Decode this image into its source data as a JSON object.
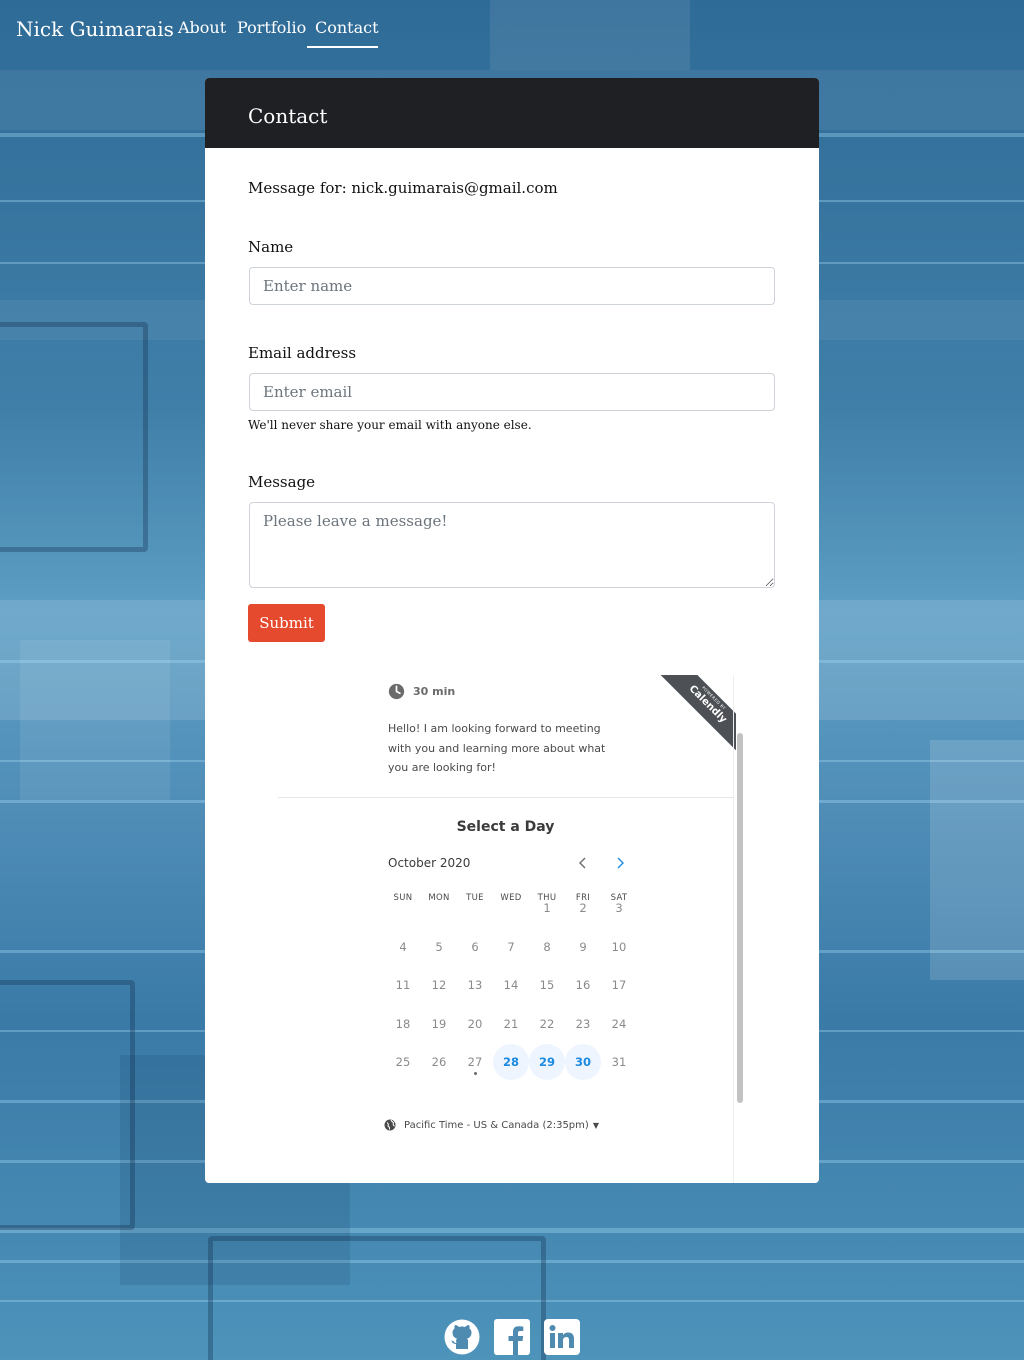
{
  "nav": {
    "brand": "Nick Guimarais",
    "links": [
      "About",
      "Portfolio",
      "Contact"
    ],
    "active": "Contact"
  },
  "card": {
    "title": "Contact",
    "message_for": "Message for: nick.guimarais@gmail.com"
  },
  "form": {
    "name_label": "Name",
    "name_placeholder": "Enter name",
    "email_label": "Email address",
    "email_placeholder": "Enter email",
    "email_help": "We'll never share your email with anyone else.",
    "message_label": "Message",
    "message_placeholder": "Please leave a message!",
    "submit_label": "Submit"
  },
  "calendly": {
    "duration": "30 min",
    "intro": "Hello! I am looking forward to meeting with you and learning more about what you are looking for!",
    "ribbon_small": "POWERED BY",
    "ribbon_brand": "Calendly",
    "heading": "Select a Day",
    "month": "October 2020",
    "weekdays": [
      "SUN",
      "MON",
      "TUE",
      "WED",
      "THU",
      "FRI",
      "SAT"
    ],
    "weeks": [
      [
        "",
        "",
        "",
        "",
        "1",
        "2",
        "3"
      ],
      [
        "4",
        "5",
        "6",
        "7",
        "8",
        "9",
        "10"
      ],
      [
        "11",
        "12",
        "13",
        "14",
        "15",
        "16",
        "17"
      ],
      [
        "18",
        "19",
        "20",
        "21",
        "22",
        "23",
        "24"
      ],
      [
        "25",
        "26",
        "27",
        "28",
        "29",
        "30",
        "31"
      ]
    ],
    "available_days": [
      "28",
      "29",
      "30"
    ],
    "today": "27",
    "timezone": "Pacific Time - US & Canada (2:35pm)",
    "accent_color": "#1b8ae0"
  },
  "footer": {
    "icons": [
      "github-icon",
      "facebook-icon",
      "linkedin-icon"
    ]
  },
  "colors": {
    "header_bg": "#1e2024",
    "submit_bg": "#e64a2e"
  }
}
